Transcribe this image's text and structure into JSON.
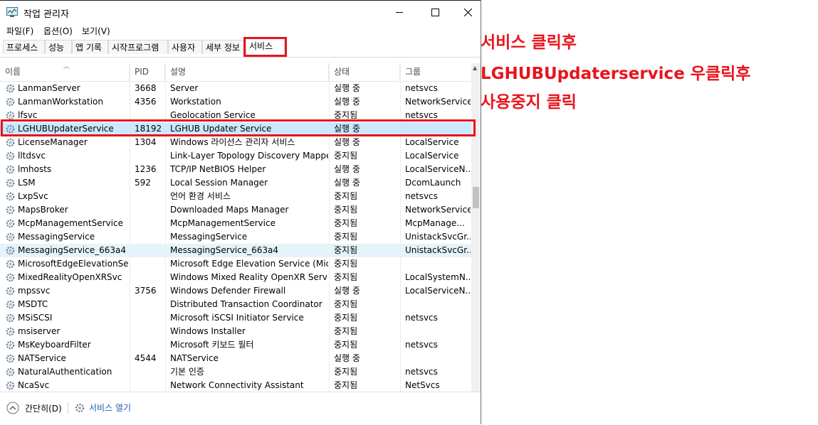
{
  "window": {
    "title": "작업 관리자"
  },
  "menu": [
    "파일(F)",
    "옵션(O)",
    "보기(V)"
  ],
  "tabs": [
    "프로세스",
    "성능",
    "앱 기록",
    "시작프로그램",
    "사용자",
    "세부 정보",
    "서비스"
  ],
  "columns": {
    "name": "이름",
    "pid": "PID",
    "desc": "설명",
    "status": "상태",
    "group": "그룹"
  },
  "rows": [
    {
      "name": "LanmanServer",
      "pid": "3668",
      "desc": "Server",
      "status": "실행 중",
      "group": "netsvcs"
    },
    {
      "name": "LanmanWorkstation",
      "pid": "4356",
      "desc": "Workstation",
      "status": "실행 중",
      "group": "NetworkService"
    },
    {
      "name": "lfsvc",
      "pid": "",
      "desc": "Geolocation Service",
      "status": "중지됨",
      "group": "netsvcs"
    },
    {
      "name": "LGHUBUpdaterService",
      "pid": "18192",
      "desc": "LGHUB Updater Service",
      "status": "실행 중",
      "group": ""
    },
    {
      "name": "LicenseManager",
      "pid": "1304",
      "desc": "Windows 라이선스 관리자 서비스",
      "status": "실행 중",
      "group": "LocalService"
    },
    {
      "name": "lltdsvc",
      "pid": "",
      "desc": "Link-Layer Topology Discovery Mapper",
      "status": "중지됨",
      "group": "LocalService"
    },
    {
      "name": "lmhosts",
      "pid": "1236",
      "desc": "TCP/IP NetBIOS Helper",
      "status": "실행 중",
      "group": "LocalServiceN..."
    },
    {
      "name": "LSM",
      "pid": "592",
      "desc": "Local Session Manager",
      "status": "실행 중",
      "group": "DcomLaunch"
    },
    {
      "name": "LxpSvc",
      "pid": "",
      "desc": "언어 환경 서비스",
      "status": "중지됨",
      "group": "netsvcs"
    },
    {
      "name": "MapsBroker",
      "pid": "",
      "desc": "Downloaded Maps Manager",
      "status": "중지됨",
      "group": "NetworkService"
    },
    {
      "name": "McpManagementService",
      "pid": "",
      "desc": "McpManagementService",
      "status": "중지됨",
      "group": "McpManage..."
    },
    {
      "name": "MessagingService",
      "pid": "",
      "desc": "MessagingService",
      "status": "중지됨",
      "group": "UnistackSvcGr..."
    },
    {
      "name": "MessagingService_663a4",
      "pid": "",
      "desc": "MessagingService_663a4",
      "status": "중지됨",
      "group": "UnistackSvcGr..."
    },
    {
      "name": "MicrosoftEdgeElevationSer...",
      "pid": "",
      "desc": "Microsoft Edge Elevation Service (Micr...",
      "status": "중지됨",
      "group": ""
    },
    {
      "name": "MixedRealityOpenXRSvc",
      "pid": "",
      "desc": "Windows Mixed Reality OpenXR Service",
      "status": "중지됨",
      "group": "LocalSystemN..."
    },
    {
      "name": "mpssvc",
      "pid": "3756",
      "desc": "Windows Defender Firewall",
      "status": "실행 중",
      "group": "LocalServiceN..."
    },
    {
      "name": "MSDTC",
      "pid": "",
      "desc": "Distributed Transaction Coordinator",
      "status": "중지됨",
      "group": ""
    },
    {
      "name": "MSiSCSI",
      "pid": "",
      "desc": "Microsoft iSCSI Initiator Service",
      "status": "중지됨",
      "group": "netsvcs"
    },
    {
      "name": "msiserver",
      "pid": "",
      "desc": "Windows Installer",
      "status": "중지됨",
      "group": ""
    },
    {
      "name": "MsKeyboardFilter",
      "pid": "",
      "desc": "Microsoft 키보드 필터",
      "status": "중지됨",
      "group": "netsvcs"
    },
    {
      "name": "NATService",
      "pid": "4544",
      "desc": "NATService",
      "status": "실행 중",
      "group": ""
    },
    {
      "name": "NaturalAuthentication",
      "pid": "",
      "desc": "기본 인증",
      "status": "중지됨",
      "group": "netsvcs"
    },
    {
      "name": "NcaSvc",
      "pid": "",
      "desc": "Network Connectivity Assistant",
      "status": "중지됨",
      "group": "NetSvcs"
    }
  ],
  "status_bar": {
    "fewer_details": "간단히(D)",
    "open_services": "서비스 열기"
  },
  "annotations": [
    "서비스 클릭후",
    "LGHUBUpdaterservice 우클릭후",
    "사용중지 클릭"
  ],
  "colors": {
    "highlight": "#e8141c",
    "selected_row": "#cce8ff",
    "hover_row": "#e5f3fb"
  }
}
